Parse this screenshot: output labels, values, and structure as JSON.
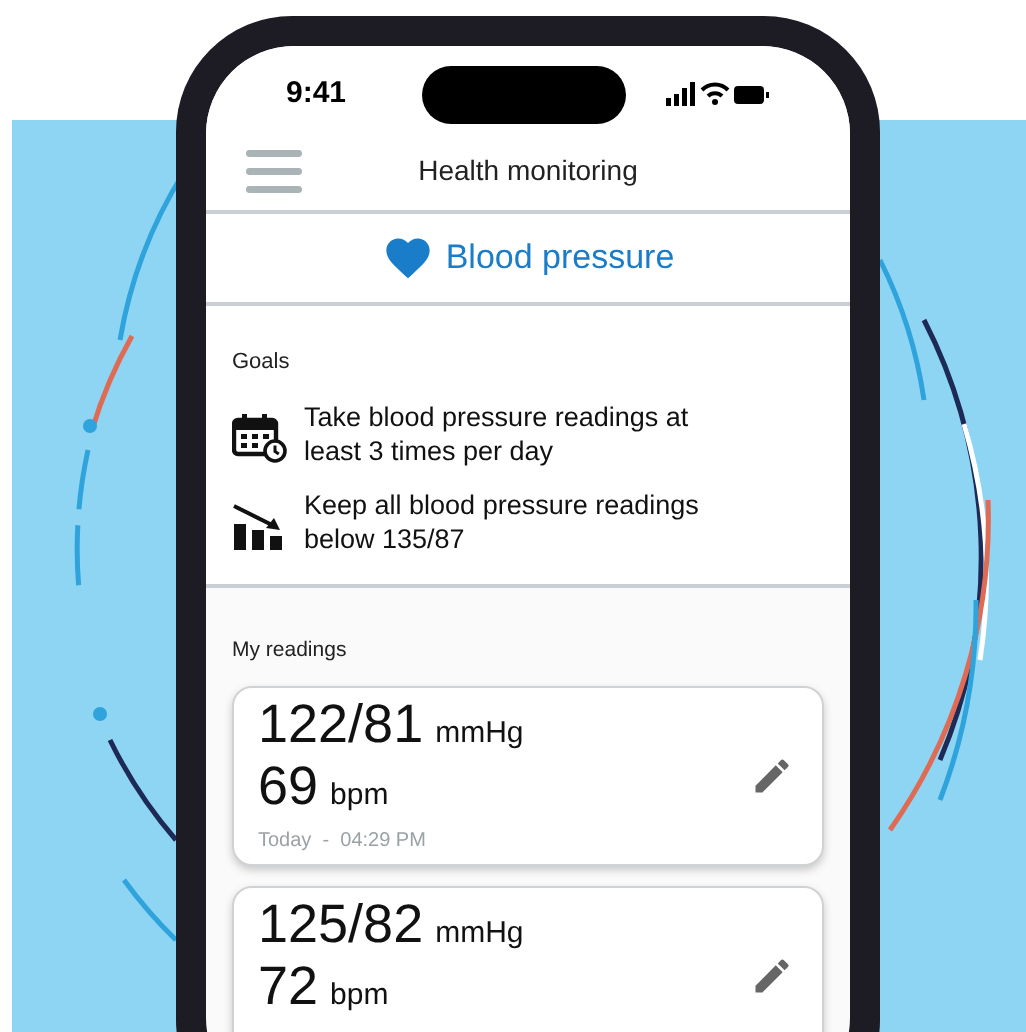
{
  "status_bar": {
    "time": "9:41"
  },
  "header": {
    "title": "Health monitoring"
  },
  "section": {
    "title": "Blood pressure"
  },
  "goals": {
    "heading": "Goals",
    "items": [
      {
        "kind": "schedule",
        "text": "Take blood pressure readings at least 3 times per day"
      },
      {
        "kind": "limit",
        "text": "Keep all blood pressure readings below 135/87"
      }
    ]
  },
  "readings": {
    "heading": "My readings",
    "items": [
      {
        "pressure": "122/81",
        "pressure_unit": "mmHg",
        "pulse": "69",
        "pulse_unit": "bpm",
        "timestamp": "Today  -  04:29 PM"
      },
      {
        "pressure": "125/82",
        "pressure_unit": "mmHg",
        "pulse": "72",
        "pulse_unit": "bpm"
      }
    ]
  }
}
